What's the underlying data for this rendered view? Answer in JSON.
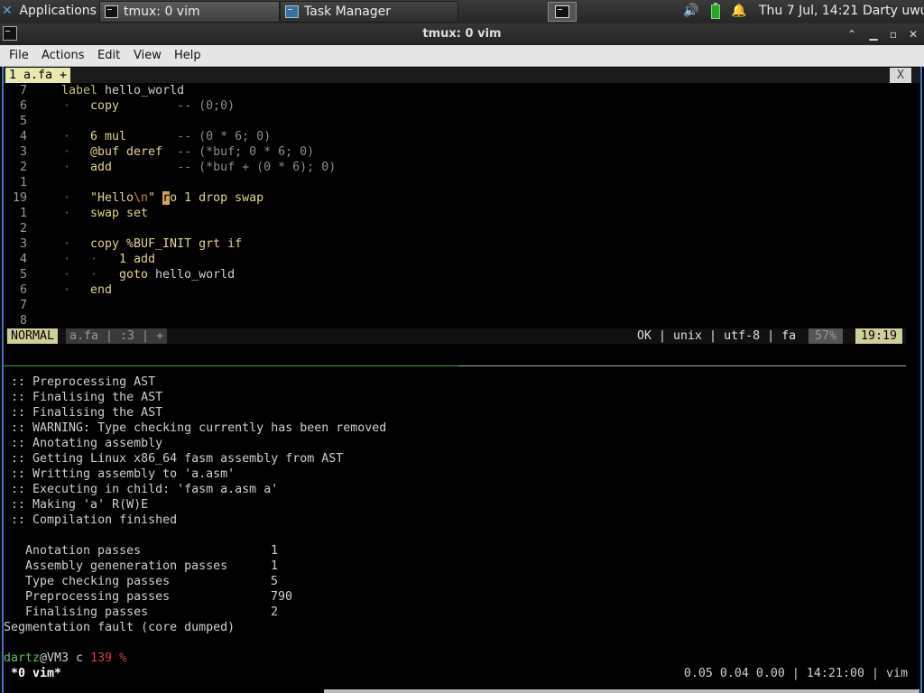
{
  "panel": {
    "applications": "Applications",
    "tasks": [
      {
        "label": "tmux: 0 vim"
      },
      {
        "label": "Task Manager"
      }
    ],
    "clock": "Thu  7 Jul, 14:21",
    "user": "Darty uwu"
  },
  "window": {
    "title": "tmux: 0 vim",
    "menu": [
      "File",
      "Actions",
      "Edit",
      "View",
      "Help"
    ]
  },
  "vim": {
    "tab_label": "1 a.fa +",
    "tab_close": "X",
    "lines": [
      {
        "num": "7",
        "indent": 0,
        "tokens": [
          {
            "t": "label",
            "c": "kw2"
          },
          {
            "t": " hello_world",
            "c": ""
          }
        ]
      },
      {
        "num": "6",
        "indent": 1,
        "tokens": [
          {
            "t": "copy",
            "c": "kw"
          },
          {
            "t": "        -- (0;0)",
            "c": "cm"
          }
        ]
      },
      {
        "num": "5",
        "indent": 0,
        "tokens": []
      },
      {
        "num": "4",
        "indent": 1,
        "tokens": [
          {
            "t": "6 mul",
            "c": "kw"
          },
          {
            "t": "       -- (0 * 6; 0)",
            "c": "cm"
          }
        ]
      },
      {
        "num": "3",
        "indent": 1,
        "tokens": [
          {
            "t": "@buf deref",
            "c": "kw"
          },
          {
            "t": "  -- (*buf; 0 * 6; 0)",
            "c": "cm"
          }
        ]
      },
      {
        "num": "2",
        "indent": 1,
        "tokens": [
          {
            "t": "add",
            "c": "kw"
          },
          {
            "t": "         -- (*buf + (0 * 6); 0)",
            "c": "cm"
          }
        ]
      },
      {
        "num": "1",
        "indent": 0,
        "tokens": []
      },
      {
        "num": "19",
        "indent": 1,
        "tokens": [
          {
            "t": "\"Hello",
            "c": "st"
          },
          {
            "t": "\\n",
            "c": "esc"
          },
          {
            "t": "\" ",
            "c": "st"
          },
          {
            "t": "r",
            "c": "cursor"
          },
          {
            "t": "o 1 drop swap",
            "c": "kw"
          }
        ]
      },
      {
        "num": "1",
        "indent": 1,
        "tokens": [
          {
            "t": "swap set",
            "c": "kw"
          }
        ]
      },
      {
        "num": "2",
        "indent": 0,
        "tokens": []
      },
      {
        "num": "3",
        "indent": 1,
        "tokens": [
          {
            "t": "copy %BUF_INIT grt if",
            "c": "kw"
          }
        ]
      },
      {
        "num": "4",
        "indent": 2,
        "tokens": [
          {
            "t": "1 add",
            "c": "kw"
          }
        ]
      },
      {
        "num": "5",
        "indent": 2,
        "tokens": [
          {
            "t": "goto",
            "c": "kw"
          },
          {
            "t": " hello_world",
            "c": ""
          }
        ]
      },
      {
        "num": "6",
        "indent": 1,
        "tokens": [
          {
            "t": "end",
            "c": "kw"
          }
        ]
      },
      {
        "num": "7",
        "indent": 0,
        "tokens": []
      },
      {
        "num": "8",
        "indent": 0,
        "tokens": []
      }
    ],
    "status": {
      "mode": "NORMAL",
      "file": "a.fa | :3 | +",
      "right": "OK | unix | utf-8 | fa",
      "percent": "57%",
      "position": "19:19"
    }
  },
  "output": {
    "lines": [
      ":: Preprocessing AST",
      ":: Finalising the AST",
      ":: Finalising the AST",
      ":: WARNING: Type checking currently has been removed",
      ":: Anotating assembly",
      ":: Getting Linux x86_64 fasm assembly from AST",
      ":: Writting assembly to 'a.asm'",
      ":: Executing in child: 'fasm a.asm a'",
      ":: Making 'a' R(W)E",
      ":: Compilation finished"
    ],
    "stats": [
      {
        "name": "Anotation passes",
        "value": "1"
      },
      {
        "name": "Assembly geneneration passes",
        "value": "1"
      },
      {
        "name": "Type checking passes",
        "value": "5"
      },
      {
        "name": "Preprocessing passes",
        "value": "790"
      },
      {
        "name": "Finalising passes",
        "value": "2"
      }
    ],
    "segfault": "Segmentation fault (core dumped)",
    "prompt": {
      "user": "dartz",
      "host": "@VM3 c ",
      "code": "139",
      "suffix": " %"
    }
  },
  "tmux": {
    "window": "*0 vim*",
    "right": "0.05 0.04 0.00 | 14:21:00 | vim"
  }
}
